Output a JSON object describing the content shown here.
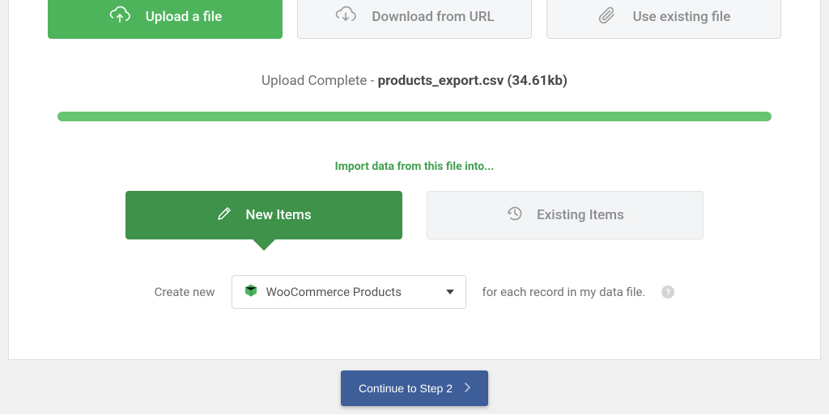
{
  "sources": {
    "upload": "Upload a file",
    "download": "Download from URL",
    "existing": "Use existing file"
  },
  "status": {
    "prefix": "Upload Complete - ",
    "filename": "products_export.csv (34.61kb)"
  },
  "prompt": "Import data from this file into...",
  "tabs": {
    "new": "New Items",
    "existing": "Existing Items"
  },
  "create": {
    "prefix": "Create new",
    "option": "WooCommerce Products",
    "suffix": "for each record in my data file.",
    "help": "?"
  },
  "continue_label": "Continue to Step 2"
}
